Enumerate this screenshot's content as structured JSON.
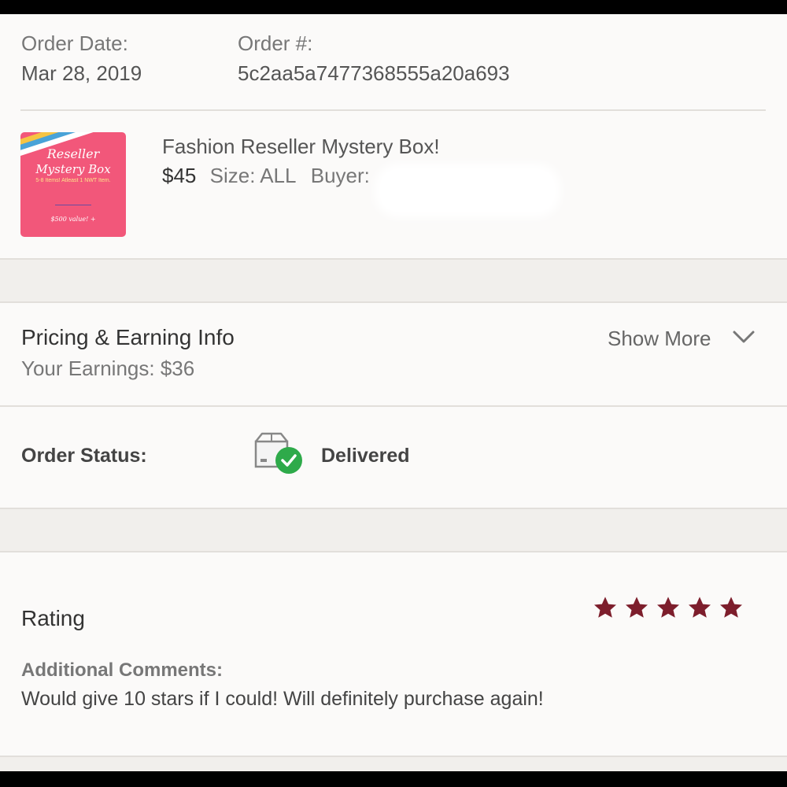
{
  "order": {
    "date_label": "Order Date:",
    "date_value": "Mar 28, 2019",
    "number_label": "Order #:",
    "number_value": "5c2aa5a7477368555a20a693"
  },
  "item": {
    "title": "Fashion Reseller Mystery Box!",
    "price": "$45",
    "size": "Size: ALL",
    "buyer_label": "Buyer:",
    "thumbnail": {
      "line1": "Reseller",
      "line2": "Mystery Box",
      "line3": "5-8 Items! Atleast 1 NWT Item.",
      "line4": "$500 value! +"
    }
  },
  "pricing": {
    "title": "Pricing & Earning Info",
    "earnings": "Your Earnings: $36",
    "show_more": "Show More"
  },
  "status": {
    "label": "Order Status:",
    "value": "Delivered"
  },
  "rating": {
    "label": "Rating",
    "stars": 5,
    "max_stars": 5,
    "comments_label": "Additional Comments:",
    "comments": "Would give 10 stars if I could! Will definitely purchase again!"
  },
  "colors": {
    "star": "#7d1e2c",
    "delivered_check": "#2eaa4a",
    "thumbnail_bg": "#f2577a",
    "panel_bg": "#fbfaf9",
    "separator_bg": "#f1efec"
  }
}
